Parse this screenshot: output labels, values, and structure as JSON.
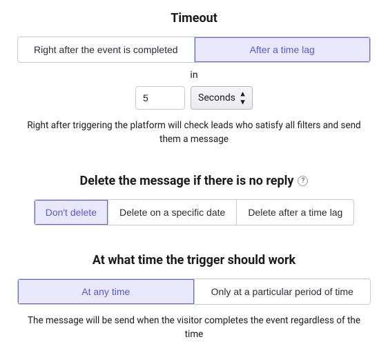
{
  "timeout": {
    "heading": "Timeout",
    "options": [
      {
        "label": "Right after the event is completed",
        "selected": false
      },
      {
        "label": "After a time lag",
        "selected": true
      }
    ],
    "in_label": "in",
    "delay_value": "5",
    "unit_selected": "Seconds",
    "caption": "Right after triggering the platform will check leads who satisfy all filters and send them a message"
  },
  "delete_msg": {
    "heading": "Delete the message if there is no reply",
    "options": [
      {
        "label": "Don't delete",
        "selected": true
      },
      {
        "label": "Delete on a specific date",
        "selected": false
      },
      {
        "label": "Delete after a time lag",
        "selected": false
      }
    ]
  },
  "trigger_time": {
    "heading": "At what time the trigger should work",
    "options": [
      {
        "label": "At any time",
        "selected": true
      },
      {
        "label": "Only at a particular period of time",
        "selected": false
      }
    ],
    "caption": "The message will be send when the visitor completes the event regardless of the time"
  }
}
